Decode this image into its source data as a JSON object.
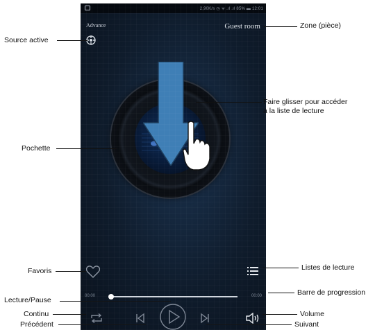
{
  "status_bar": {
    "right_text": "2,90K/s ◷ ᯤ .ıl .ıl 85% ▬ 12:01"
  },
  "player": {
    "source_label": "Advance",
    "room_name": "Guest room",
    "elapsed": "00:00",
    "duration": "00:00",
    "progress": 0.0
  },
  "annotations": {
    "source_active": "Source active",
    "zone": "Zone (pièce)",
    "drag_playlist_line1": "Faire glisser pour accéder",
    "drag_playlist_line2": "à la liste de lecture",
    "cover": "Pochette",
    "favorites": "Favoris",
    "playlists": "Listes de lecture",
    "progress_bar": "Barre de progression",
    "play_pause": "Lecture/Pause",
    "volume": "Volume",
    "repeat": "Continu",
    "previous": "Précédent",
    "next": "Suivant"
  },
  "colors": {
    "arrow": "#3f7fb6",
    "screen_bg": "#0f1c2c",
    "controls": "#7f8896"
  },
  "icons": [
    "source-icon",
    "heart-icon",
    "playlist-icon",
    "repeat-icon",
    "previous-icon",
    "play-icon",
    "next-icon",
    "volume-icon",
    "swipe-down-arrow-icon",
    "hand-icon"
  ]
}
